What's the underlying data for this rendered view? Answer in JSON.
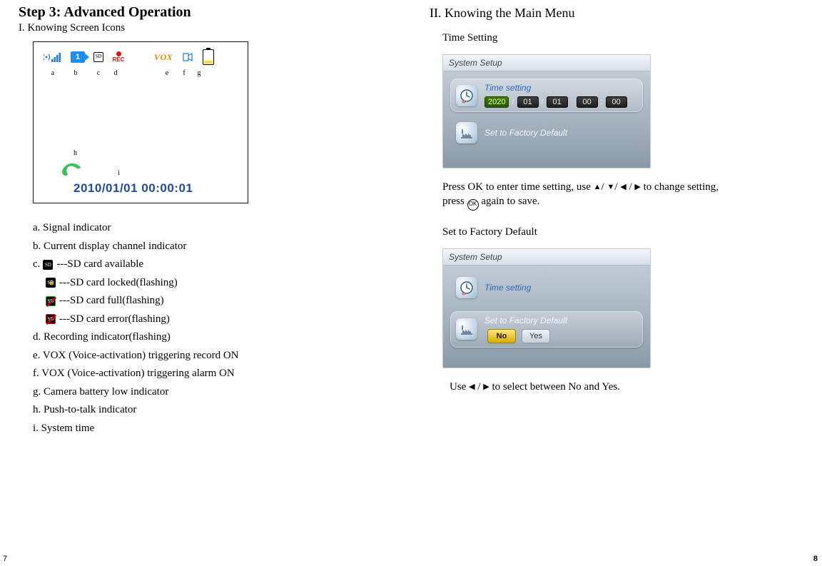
{
  "left": {
    "step_title": "Step 3: Advanced Operation",
    "section1": "I. Knowing Screen Icons",
    "icon_labels": {
      "a": "a",
      "b": "b",
      "c": "c",
      "d": "d",
      "e": "e",
      "f": "f",
      "g": "g",
      "h": "h",
      "i": "i"
    },
    "channel_number": "1",
    "rec_label": "REC",
    "vox_label": "VOX",
    "system_time": "2010/01/01 00:00:01",
    "legend": {
      "a": "a. Signal indicator",
      "b": "b. Current display channel indicator",
      "c_prefix": "c.",
      "c_avail": " ---SD card available",
      "c_locked": " ---SD card locked(flashing)",
      "c_full": " ---SD card full(flashing)",
      "c_error": " ---SD card error(flashing)",
      "d": "d. Recording indicator(flashing)",
      "e": "e. VOX (Voice-activation) triggering record ON",
      "f": "f.  VOX (Voice-activation) triggering alarm ON",
      "g": "g. Camera battery low indicator",
      "h": "h. Push-to-talk indicator",
      "i": "i.  System time"
    },
    "page_number": "7"
  },
  "right": {
    "section2": "II.  Knowing the Main Menu",
    "time_heading": "Time Setting",
    "menubar": "System Setup",
    "menu_time_label": "Time setting",
    "menu_factory_label": "Set to Factory Default",
    "date": {
      "year": "2020",
      "m": "01",
      "d": "01",
      "hh": "00",
      "mm": "00",
      "slash": "/",
      "colon": ":"
    },
    "hint1_part1": "Press OK to enter time setting, use ",
    "hint1_up": "▲",
    "hint1_sep": "/ ",
    "hint1_down": "▼",
    "hint1_left": "◀",
    "hint1_right": "▶",
    "hint1_part2": " to change setting,",
    "hint1_line2_a": "press ",
    "hint1_ok": "OK",
    "hint1_line2_b": "  again to save.",
    "factory_heading": "Set to Factory Default",
    "no": "No",
    "yes": "Yes",
    "hint2_a": "Use  ",
    "hint2_b": " / ",
    "hint2_c": " to select between  No and Yes.",
    "page_number": "8"
  }
}
